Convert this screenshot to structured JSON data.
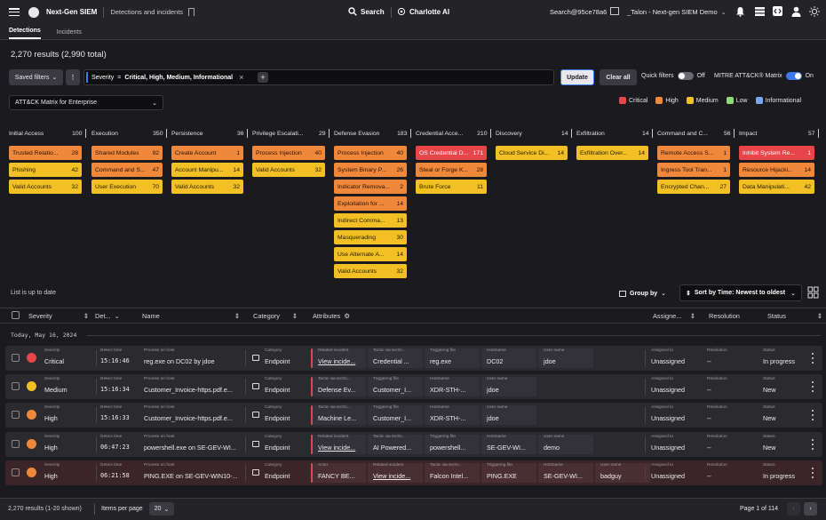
{
  "topbar": {
    "product": "Next-Gen SIEM",
    "breadcrumb": "Detections and incidents",
    "search_label": "Search",
    "charlotte_label": "Charlotte AI",
    "tenant_id": "Search@95ce78a6",
    "tenant_name": "_Talon - Next-gen SIEM Demo"
  },
  "tabs": [
    "Detections",
    "Incidents"
  ],
  "results_summary": "2,270 results (2,990 total)",
  "filters": {
    "saved_filters": "Saved filters",
    "filter_key": "Severity",
    "filter_op": "=",
    "filter_value": "Critical, High, Medium, Informational",
    "update": "Update",
    "clear_all": "Clear all",
    "quick_filters": "Quick filters",
    "quick_filters_state": "Off",
    "mitre_toggle": "MITRE ATT&CK® Matrix",
    "mitre_state": "On"
  },
  "matrix_select": "ATT&CK Matrix for Enterprise",
  "legend": [
    {
      "label": "Critical",
      "color": "#e8454a"
    },
    {
      "label": "High",
      "color": "#f0883c"
    },
    {
      "label": "Medium",
      "color": "#f2c024"
    },
    {
      "label": "Low",
      "color": "#8fd97a"
    },
    {
      "label": "Informational",
      "color": "#7aa6f0"
    }
  ],
  "tactics": [
    {
      "name": "Initial Access",
      "count": "100",
      "techniques": [
        {
          "name": "Trusted Relatio...",
          "count": "28",
          "sev": "high"
        },
        {
          "name": "Phishing",
          "count": "42",
          "sev": "med"
        },
        {
          "name": "Valid Accounts",
          "count": "32",
          "sev": "med"
        }
      ]
    },
    {
      "name": "Execution",
      "count": "350",
      "techniques": [
        {
          "name": "Shared Modules",
          "count": "92",
          "sev": "high"
        },
        {
          "name": "Command and S...",
          "count": "47",
          "sev": "high"
        },
        {
          "name": "User Execution",
          "count": "70",
          "sev": "med"
        }
      ]
    },
    {
      "name": "Persistence",
      "count": "36",
      "techniques": [
        {
          "name": "Create Account",
          "count": "1",
          "sev": "high"
        },
        {
          "name": "Account Manipu...",
          "count": "14",
          "sev": "med"
        },
        {
          "name": "Valid Accounts",
          "count": "32",
          "sev": "med"
        }
      ]
    },
    {
      "name": "Privilege Escalati...",
      "count": "29",
      "techniques": [
        {
          "name": "Process Injection",
          "count": "40",
          "sev": "high"
        },
        {
          "name": "Valid Accounts",
          "count": "32",
          "sev": "med"
        }
      ]
    },
    {
      "name": "Defense Evasion",
      "count": "183",
      "techniques": [
        {
          "name": "Process Injection",
          "count": "40",
          "sev": "high"
        },
        {
          "name": "System Binary P...",
          "count": "26",
          "sev": "high"
        },
        {
          "name": "Indicator Remova...",
          "count": "2",
          "sev": "high"
        },
        {
          "name": "Exploitation for ...",
          "count": "14",
          "sev": "high"
        },
        {
          "name": "Indirect Comma...",
          "count": "13",
          "sev": "med"
        },
        {
          "name": "Masquerading",
          "count": "30",
          "sev": "med"
        },
        {
          "name": "Use Alternate A...",
          "count": "14",
          "sev": "med"
        },
        {
          "name": "Valid Accounts",
          "count": "32",
          "sev": "med"
        }
      ]
    },
    {
      "name": "Credential Acce...",
      "count": "210",
      "techniques": [
        {
          "name": "OS Credential D...",
          "count": "171",
          "sev": "crit"
        },
        {
          "name": "Steal or Forge K...",
          "count": "28",
          "sev": "high"
        },
        {
          "name": "Brute Force",
          "count": "11",
          "sev": "med"
        }
      ]
    },
    {
      "name": "Discovery",
      "count": "14",
      "techniques": [
        {
          "name": "Cloud Service Di...",
          "count": "14",
          "sev": "med"
        }
      ]
    },
    {
      "name": "Exfiltration",
      "count": "14",
      "techniques": [
        {
          "name": "Exfiltration Over...",
          "count": "14",
          "sev": "med"
        }
      ]
    },
    {
      "name": "Command and C...",
      "count": "56",
      "techniques": [
        {
          "name": "Remote Access S...",
          "count": "1",
          "sev": "high"
        },
        {
          "name": "Ingress Tool Tran...",
          "count": "1",
          "sev": "high"
        },
        {
          "name": "Encrypted Chan...",
          "count": "27",
          "sev": "med"
        }
      ]
    },
    {
      "name": "Impact",
      "count": "57",
      "techniques": [
        {
          "name": "Inhibit System Re...",
          "count": "1",
          "sev": "crit"
        },
        {
          "name": "Resource Hijacki...",
          "count": "14",
          "sev": "high"
        },
        {
          "name": "Data Manipulati...",
          "count": "42",
          "sev": "med"
        }
      ]
    }
  ],
  "list_status": "List is up to date",
  "group_by": "Group by",
  "sort_by": "Sort by Time: Newest to oldest",
  "columns": {
    "severity": "Severity",
    "detect": "Det...",
    "name": "Name",
    "category": "Category",
    "attributes": "Attributes",
    "assignee": "Assigne...",
    "resolution": "Resolution",
    "status": "Status"
  },
  "date_group": "Today, May 16, 2024",
  "rows": [
    {
      "sev_label": "Severity",
      "sev": "Critical",
      "sev_color": "#e8454a",
      "time_label": "Detect time",
      "time": "15:16:46",
      "name_label": "Process on host",
      "name": "reg.exe on DC02 by jdoe",
      "cat_label": "Category",
      "cat": "Endpoint",
      "attrs": [
        {
          "label": "Related incident",
          "value": "View incide...",
          "link": true
        },
        {
          "label": "Tactic via techn...",
          "value": "Credential ..."
        },
        {
          "label": "Triggering file",
          "value": "reg.exe"
        },
        {
          "label": "Hostname",
          "value": "DC02"
        },
        {
          "label": "User name",
          "value": "jdoe"
        }
      ],
      "assigned_label": "Assigned to",
      "assigned": "Unassigned",
      "resolution_label": "Resolution",
      "resolution": "--",
      "status_label": "Status",
      "status": "In progress"
    },
    {
      "sev_label": "Severity",
      "sev": "Medium",
      "sev_color": "#f2c024",
      "time_label": "Detect time",
      "time": "15:16:34",
      "name_label": "Process on host",
      "name": "Customer_Invoice-https.pdf.e...",
      "cat_label": "Category",
      "cat": "Endpoint",
      "attrs": [
        {
          "label": "Tactic via techn...",
          "value": "Defense Ev..."
        },
        {
          "label": "Triggering file",
          "value": "Customer_I..."
        },
        {
          "label": "Hostname",
          "value": "XDR-STH-..."
        },
        {
          "label": "User name",
          "value": "jdoe"
        }
      ],
      "assigned_label": "Assigned to",
      "assigned": "Unassigned",
      "resolution_label": "Resolution",
      "resolution": "--",
      "status_label": "Status",
      "status": "New"
    },
    {
      "sev_label": "Severity",
      "sev": "High",
      "sev_color": "#f0883c",
      "time_label": "Detect time",
      "time": "15:16:33",
      "name_label": "Process on host",
      "name": "Customer_Invoice-https.pdf.e...",
      "cat_label": "Category",
      "cat": "Endpoint",
      "attrs": [
        {
          "label": "Tactic via techn...",
          "value": "Machine Le..."
        },
        {
          "label": "Triggering file",
          "value": "Customer_I..."
        },
        {
          "label": "Hostname",
          "value": "XDR-STH-..."
        },
        {
          "label": "User name",
          "value": "jdoe"
        }
      ],
      "assigned_label": "Assigned to",
      "assigned": "Unassigned",
      "resolution_label": "Resolution",
      "resolution": "--",
      "status_label": "Status",
      "status": "New"
    },
    {
      "sev_label": "Severity",
      "sev": "High",
      "sev_color": "#f0883c",
      "time_label": "Detect time",
      "time": "06:47:23",
      "name_label": "Process on host",
      "name": "powershell.exe on SE-GEV-WI...",
      "cat_label": "Category",
      "cat": "Endpoint",
      "attrs": [
        {
          "label": "Related incident",
          "value": "View incide...",
          "link": true
        },
        {
          "label": "Tactic via techn...",
          "value": "AI Powered..."
        },
        {
          "label": "Triggering file",
          "value": "powershell..."
        },
        {
          "label": "Hostname",
          "value": "SE-GEV-WI..."
        },
        {
          "label": "User name",
          "value": "demo"
        }
      ],
      "assigned_label": "Assigned to",
      "assigned": "Unassigned",
      "resolution_label": "Resolution",
      "resolution": "--",
      "status_label": "Status",
      "status": "New"
    },
    {
      "sev_label": "Severity",
      "sev": "High",
      "sev_color": "#f0883c",
      "time_label": "Detect time",
      "time": "06:21:58",
      "name_label": "Process on host",
      "name": "PING.EXE on SE-GEV-WIN10-...",
      "cat_label": "Category",
      "cat": "Endpoint",
      "attrs": [
        {
          "label": "Actor",
          "value": "FANCY BE..."
        },
        {
          "label": "Related incident",
          "value": "View incide...",
          "link": true
        },
        {
          "label": "Tactic via techn...",
          "value": "Falcon Intel..."
        },
        {
          "label": "Triggering file",
          "value": "PING.EXE"
        },
        {
          "label": "Hostname",
          "value": "SE-GEV-WI..."
        },
        {
          "label": "User name",
          "value": "badguy"
        }
      ],
      "assigned_label": "Assigned to",
      "assigned": "Unassigned",
      "resolution_label": "Resolution",
      "resolution": "--",
      "status_label": "Status",
      "status": "In progress"
    }
  ],
  "footer": {
    "shown": "2,270 results (1-20 shown)",
    "per_page_label": "Items per page",
    "per_page": "20",
    "page": "Page 1 of 114"
  }
}
